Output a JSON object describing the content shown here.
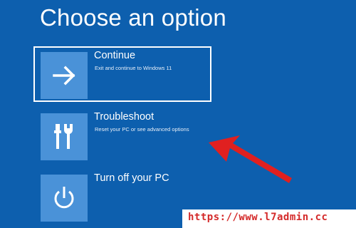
{
  "page": {
    "title": "Choose an option"
  },
  "options": [
    {
      "title": "Continue",
      "description": "Exit and continue to Windows 11",
      "icon": "arrow-right-icon",
      "selected": true
    },
    {
      "title": "Troubleshoot",
      "description": "Reset your PC or see advanced options",
      "icon": "tools-icon",
      "selected": false
    },
    {
      "title": "Turn off your PC",
      "description": "",
      "icon": "power-icon",
      "selected": false
    }
  ],
  "annotation": {
    "color": "#e02020",
    "icon": "red-arrow-pointer"
  },
  "watermark": {
    "text": "https://www.l7admin.cc",
    "color": "#d42a2a"
  },
  "colors": {
    "background": "#0d5fae",
    "tile": "#4a92d8",
    "text": "#ffffff"
  }
}
